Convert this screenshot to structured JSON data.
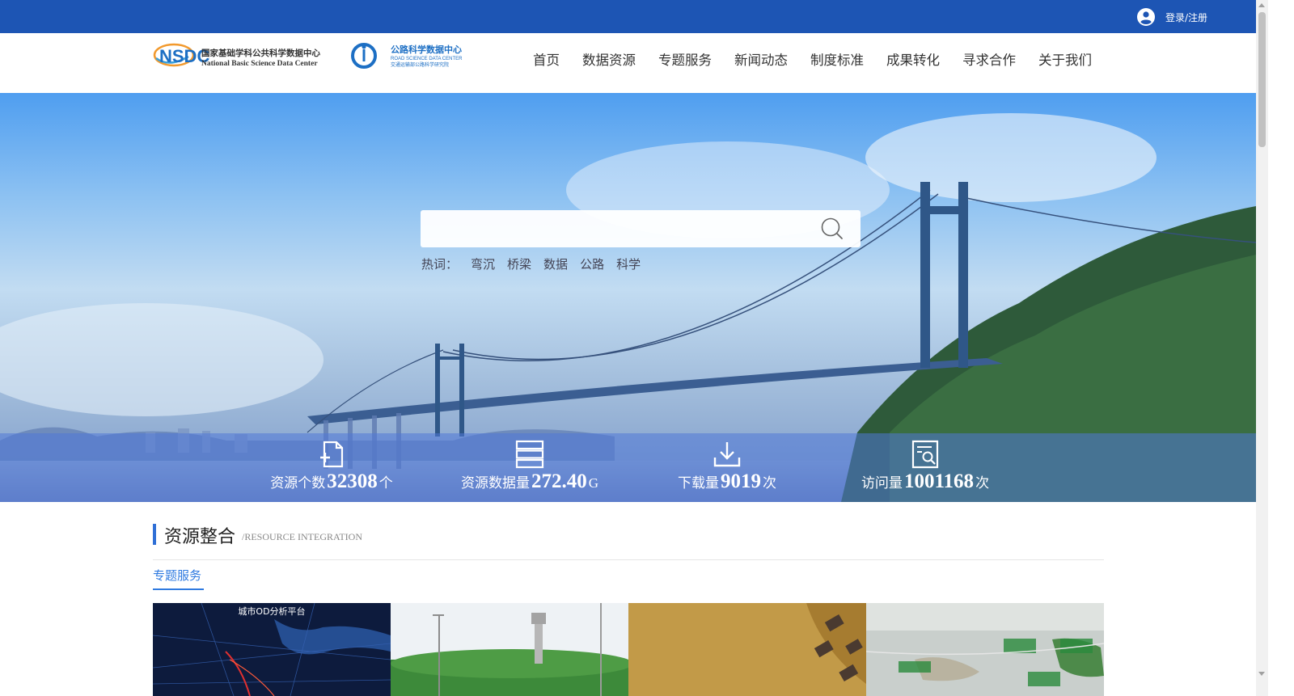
{
  "topbar": {
    "login_label": "登录/注册",
    "icons": {
      "user": "user-circle-icon"
    }
  },
  "header": {
    "logo_nsdc": {
      "mark": "NSDC",
      "cn": "国家基础学科公共科学数据中心",
      "en": "National Basic Science Data Center"
    },
    "logo_road": {
      "cn": "公路科学数据中心",
      "en": "ROAD SCIENCE DATA CENTER",
      "sub": "交通运输部公路科学研究院"
    },
    "nav": [
      "首页",
      "数据资源",
      "专题服务",
      "新闻动态",
      "制度标准",
      "成果转化",
      "寻求合作",
      "关于我们"
    ]
  },
  "hero": {
    "search": {
      "value": "",
      "placeholder": ""
    },
    "hot_label": "热词：",
    "hot_words": [
      "弯沉",
      "桥梁",
      "数据",
      "公路",
      "科学"
    ],
    "stats": [
      {
        "label": "资源个数",
        "value": "32308",
        "unit": "个",
        "icon": "file-add-icon"
      },
      {
        "label": "资源数据量",
        "value": "272.40",
        "unit": "G",
        "icon": "database-icon"
      },
      {
        "label": "下载量",
        "value": "9019",
        "unit": "次",
        "icon": "download-icon"
      },
      {
        "label": "访问量",
        "value": "1001168",
        "unit": "次",
        "icon": "document-search-icon"
      }
    ]
  },
  "section": {
    "title": "资源整合",
    "subtitle": "/RESOURCE INTEGRATION",
    "tab": "专题服务",
    "cards": [
      {
        "title": "城市OD分析平台"
      },
      {
        "title": ""
      },
      {
        "title": ""
      },
      {
        "title": ""
      }
    ]
  },
  "colors": {
    "topbar": "#1d55b4",
    "accent": "#2f7ae0"
  }
}
